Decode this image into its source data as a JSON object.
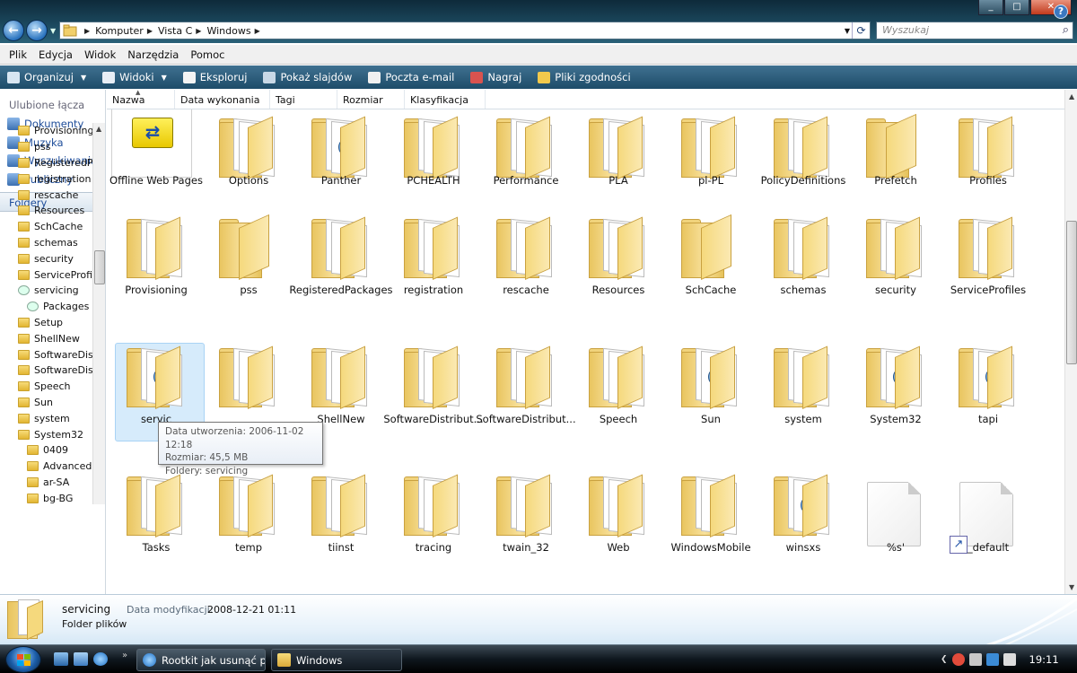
{
  "window": {
    "minimize": "_",
    "maximize": "□",
    "close": "✕"
  },
  "address": {
    "crumbs": [
      "Komputer",
      "Vista C",
      "Windows"
    ]
  },
  "search": {
    "placeholder": "Wyszukaj"
  },
  "menu": [
    "Plik",
    "Edycja",
    "Widok",
    "Narzędzia",
    "Pomoc"
  ],
  "commands": [
    {
      "label": "Organizuj",
      "icon": "organize-icon",
      "color": "#d8e6f2",
      "dropdown": true
    },
    {
      "label": "Widoki",
      "icon": "views-icon",
      "color": "#e8eef5",
      "dropdown": true
    },
    {
      "label": "Eksploruj",
      "icon": "explore-icon",
      "color": "#f4f4f4",
      "dropdown": false
    },
    {
      "label": "Pokaż slajdów",
      "icon": "slideshow-icon",
      "color": "#c9d8e6",
      "dropdown": false
    },
    {
      "label": "Poczta e-mail",
      "icon": "email-icon",
      "color": "#f0f0f0",
      "dropdown": false
    },
    {
      "label": "Nagraj",
      "icon": "burn-icon",
      "color": "#d9534f",
      "dropdown": false
    },
    {
      "label": "Pliki zgodności",
      "icon": "compat-files-icon",
      "color": "#f2c94c",
      "dropdown": false
    }
  ],
  "favorites": {
    "title": "Ulubione łącza",
    "items": [
      "Dokumenty",
      "Muzyka",
      "Wyszukiwania",
      "Publiczny"
    ]
  },
  "folders_header": "Foldery",
  "tree": [
    {
      "label": "Provisioning",
      "level": 1
    },
    {
      "label": "pss",
      "level": 1
    },
    {
      "label": "RegisteredPa",
      "level": 1
    },
    {
      "label": "registration",
      "level": 1
    },
    {
      "label": "rescache",
      "level": 1
    },
    {
      "label": "Resources",
      "level": 1
    },
    {
      "label": "SchCache",
      "level": 1
    },
    {
      "label": "schemas",
      "level": 1
    },
    {
      "label": "security",
      "level": 1
    },
    {
      "label": "ServiceProfil",
      "level": 1
    },
    {
      "label": "servicing",
      "level": 1,
      "open": true
    },
    {
      "label": "Packages",
      "level": 2,
      "open": true
    },
    {
      "label": "Setup",
      "level": 1
    },
    {
      "label": "ShellNew",
      "level": 1
    },
    {
      "label": "SoftwareDist",
      "level": 1
    },
    {
      "label": "SoftwareDist",
      "level": 1
    },
    {
      "label": "Speech",
      "level": 1
    },
    {
      "label": "Sun",
      "level": 1
    },
    {
      "label": "system",
      "level": 1
    },
    {
      "label": "System32",
      "level": 1
    },
    {
      "label": "0409",
      "level": 2
    },
    {
      "label": "AdvancedI",
      "level": 2
    },
    {
      "label": "ar-SA",
      "level": 2
    },
    {
      "label": "bg-BG",
      "level": 2
    }
  ],
  "columns": [
    "Nazwa",
    "Data wykonania",
    "Tagi",
    "Rozmiar",
    "Klasyfikacja"
  ],
  "rows": [
    [
      "Offline Web Pages",
      "Options",
      "Panther",
      "PCHEALTH",
      "Performance",
      "PLA",
      "pl-PL",
      "PolicyDefinitions",
      "Prefetch",
      "Profiles"
    ],
    [
      "Provisioning",
      "pss",
      "RegisteredPackages",
      "registration",
      "rescache",
      "Resources",
      "SchCache",
      "schemas",
      "security",
      "ServiceProfiles"
    ],
    [
      "servicing",
      "Setup",
      "ShellNew",
      "ShellNew",
      "SoftwareDistribut...",
      "SoftwareDistribut...",
      "Speech",
      "Sun",
      "system",
      "System32",
      "tapi"
    ],
    [
      "Tasks",
      "temp",
      "tiinst",
      "tracing",
      "twain_32",
      "Web",
      "WindowsMobile",
      "winsxs",
      "%s'",
      "_default"
    ]
  ],
  "row3_visible": [
    "servic",
    "",
    "ShellNew",
    "SoftwareDistribut...",
    "SoftwareDistribut...",
    "Speech",
    "Sun",
    "system",
    "System32",
    "tapi"
  ],
  "tooltip": {
    "line1": "Data utworzenia: 2006-11-02 12:18",
    "line2": "Rozmiar: 45,5 MB",
    "line3": "Foldery: servicing"
  },
  "details": {
    "name": "servicing",
    "type": "Folder plików",
    "mod_label": "Data modyfikacji:",
    "mod_value": "2008-12-21 01:11"
  },
  "taskbar": {
    "tasks": [
      "Rootkit jak usunąć p...",
      "Windows"
    ],
    "clock": "19:11"
  }
}
